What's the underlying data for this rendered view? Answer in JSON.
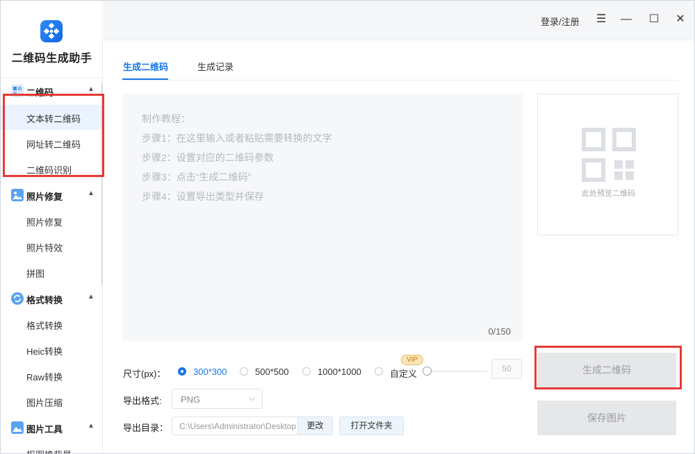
{
  "app": {
    "name": "二维码生成助手"
  },
  "window": {
    "login_label": "登录/注册"
  },
  "sidebar": {
    "groups": [
      {
        "title": "二维码",
        "icon": "qr-group-icon",
        "items": [
          "文本转二维码",
          "网址转二维码",
          "二维码识别"
        ]
      },
      {
        "title": "照片修复",
        "icon": "photo-group-icon",
        "items": [
          "照片修复",
          "照片特效",
          "拼图"
        ]
      },
      {
        "title": "格式转换",
        "icon": "convert-group-icon",
        "items": [
          "格式转换",
          "Heic转换",
          "Raw转换",
          "图片压缩"
        ]
      },
      {
        "title": "图片工具",
        "icon": "image-tools-icon",
        "items": [
          "抠图换背景"
        ]
      }
    ],
    "active_item": "文本转二维码"
  },
  "tabs": [
    {
      "label": "生成二维码",
      "active": true
    },
    {
      "label": "生成记录",
      "active": false
    }
  ],
  "editor": {
    "hints": [
      "制作教程：",
      "步骤1：在这里输入或者粘贴需要转换的文字",
      "步骤2：设置对应的二维码参数",
      "步骤3：点击“生成二维码”",
      "步骤4：设置导出类型并保存"
    ],
    "counter": "0/150"
  },
  "preview": {
    "caption": "此处预览二维码"
  },
  "options": {
    "size_label": "尺寸(px)：",
    "sizes": [
      {
        "label": "300*300",
        "checked": true
      },
      {
        "label": "500*500",
        "checked": false
      },
      {
        "label": "1000*1000",
        "checked": false
      },
      {
        "label": "自定义",
        "checked": false
      }
    ],
    "vip_badge": "VIP",
    "custom_value": "50",
    "format_label": "导出格式:",
    "format_value": "PNG",
    "dir_label": "导出目录：",
    "dir_value": "C:\\Users\\Administrator\\Desktop",
    "change_label": "更改",
    "open_folder_label": "打开文件夹"
  },
  "actions": {
    "generate_label": "生成二维码",
    "save_label": "保存图片"
  },
  "colors": {
    "accent": "#1677e6",
    "highlight_box": "#e53935"
  }
}
